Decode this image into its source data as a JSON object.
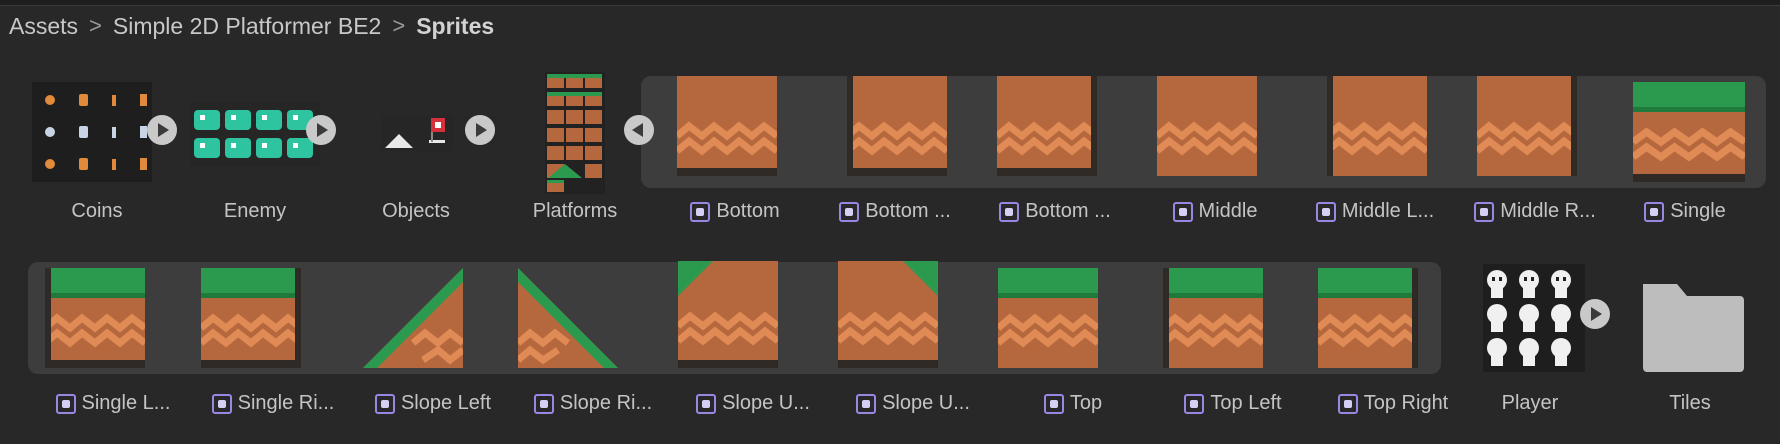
{
  "breadcrumb": {
    "items": [
      "Assets",
      "Simple 2D Platformer BE2",
      "Sprites"
    ],
    "separator": ">"
  },
  "assets_row1": [
    {
      "label": "Coins",
      "type": "sprite-sheet",
      "expand": "collapsed"
    },
    {
      "label": "Enemy",
      "type": "sprite-sheet",
      "expand": "collapsed"
    },
    {
      "label": "Objects",
      "type": "sprite-sheet",
      "expand": "collapsed"
    },
    {
      "label": "Platforms",
      "type": "sprite-sheet",
      "expand": "expanded"
    },
    {
      "label": "Bottom",
      "type": "sprite"
    },
    {
      "label": "Bottom ...",
      "type": "sprite"
    },
    {
      "label": "Bottom ...",
      "type": "sprite"
    },
    {
      "label": "Middle",
      "type": "sprite"
    },
    {
      "label": "Middle L...",
      "type": "sprite"
    },
    {
      "label": "Middle R...",
      "type": "sprite"
    },
    {
      "label": "Single",
      "type": "sprite"
    }
  ],
  "assets_row2": [
    {
      "label": "Single L...",
      "type": "sprite"
    },
    {
      "label": "Single Ri...",
      "type": "sprite"
    },
    {
      "label": "Slope Left",
      "type": "sprite"
    },
    {
      "label": "Slope Ri...",
      "type": "sprite"
    },
    {
      "label": "Slope U...",
      "type": "sprite"
    },
    {
      "label": "Slope U...",
      "type": "sprite"
    },
    {
      "label": "Top",
      "type": "sprite"
    },
    {
      "label": "Top Left",
      "type": "sprite"
    },
    {
      "label": "Top Right",
      "type": "sprite"
    },
    {
      "label": "Player",
      "type": "sprite-sheet",
      "expand": "collapsed"
    },
    {
      "label": "Tiles",
      "type": "folder"
    }
  ],
  "colors": {
    "background": "#282828",
    "group_background": "#3d3d3d",
    "dirt": "#b5673d",
    "dirt_wave": "#e08a55",
    "grass": "#2c9a4e",
    "grass_dark": "#1f7a3b",
    "outline": "#2f2a26",
    "sprite_icon": "#9b86e4",
    "folder": "#bdbdbd"
  }
}
